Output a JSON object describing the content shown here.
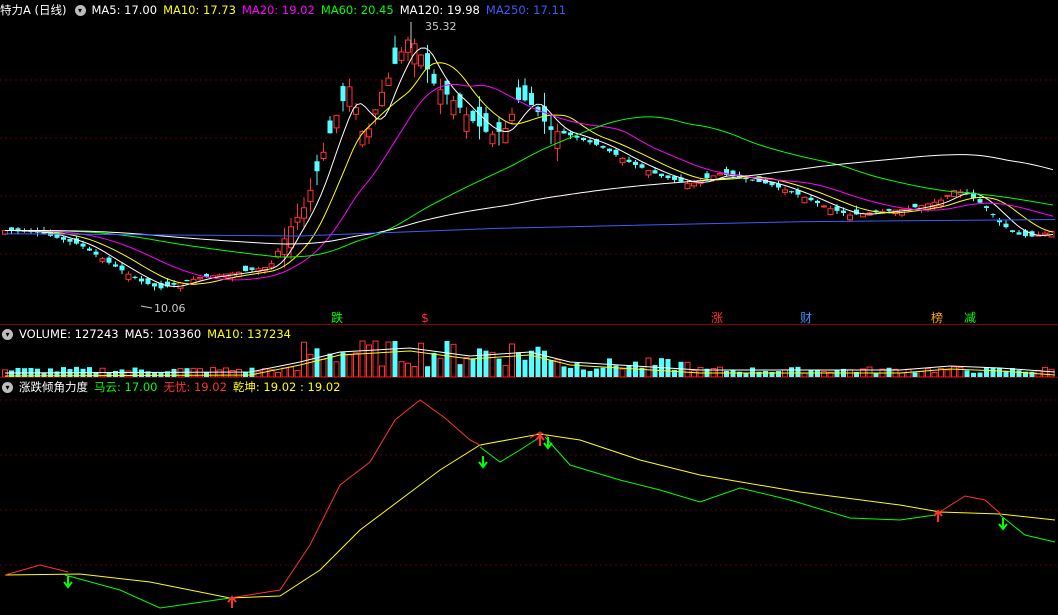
{
  "price_panel": {
    "title": "特力A (日线)",
    "ma": [
      {
        "label": "MA5: 17.00",
        "color": "#ffffff"
      },
      {
        "label": "MA10: 17.73",
        "color": "#ffff00"
      },
      {
        "label": "MA20: 19.02",
        "color": "#ff00ff"
      },
      {
        "label": "MA60: 20.45",
        "color": "#00ff00"
      },
      {
        "label": "MA120: 19.98",
        "color": "#ffffff"
      },
      {
        "label": "MA250: 17.11",
        "color": "#3a5cff"
      }
    ],
    "high_label": "35.32",
    "low_label": "10.06",
    "markers": [
      {
        "text": "跌",
        "color": "#00ff00"
      },
      {
        "text": "$",
        "color": "#ff3030"
      },
      {
        "text": "涨",
        "color": "#ff3030"
      },
      {
        "text": "财",
        "color": "#3a8cff"
      },
      {
        "text": "榜",
        "color": "#ffa500"
      },
      {
        "text": "减",
        "color": "#00ff00"
      }
    ]
  },
  "volume_panel": {
    "labels": [
      {
        "label": "VOLUME: 127243",
        "color": "#ffffff"
      },
      {
        "label": "MA5: 103360",
        "color": "#ffffff"
      },
      {
        "label": "MA10: 137234",
        "color": "#ffff00"
      }
    ]
  },
  "indicator_panel": {
    "labels": [
      {
        "label": "涨跌倾角力度",
        "color": "#ffffff"
      },
      {
        "label": "马云: 17.00",
        "color": "#00ff00"
      },
      {
        "label": "无忧: 19.02",
        "color": "#ff3030"
      },
      {
        "label": "乾坤: 19.02 : 19.02",
        "color": "#ffff00"
      }
    ]
  },
  "colors": {
    "up": "#ff3030",
    "down": "#54ffff",
    "grid": "#5a0000"
  },
  "icons": {
    "panel_toggle": "chevron-down-icon"
  },
  "chart_data": [
    {
      "type": "candlestick",
      "title": "特力A (日线)",
      "ylim": [
        10,
        36
      ],
      "high": 35.32,
      "low": 10.06,
      "series": [
        {
          "name": "MA5",
          "values": [
            17.0
          ]
        },
        {
          "name": "MA10",
          "values": [
            17.73
          ]
        },
        {
          "name": "MA20",
          "values": [
            19.02
          ]
        },
        {
          "name": "MA60",
          "values": [
            20.45
          ]
        },
        {
          "name": "MA120",
          "values": [
            19.98
          ]
        },
        {
          "name": "MA250",
          "values": [
            17.11
          ]
        }
      ]
    },
    {
      "type": "bar",
      "series": [
        {
          "name": "VOLUME",
          "values": [
            127243
          ]
        },
        {
          "name": "MA5",
          "values": [
            103360
          ]
        },
        {
          "name": "MA10",
          "values": [
            137234
          ]
        }
      ]
    },
    {
      "type": "line",
      "title": "涨跌倾角力度",
      "series": [
        {
          "name": "马云",
          "values": [
            17.0
          ]
        },
        {
          "name": "无忧",
          "values": [
            19.02
          ]
        },
        {
          "name": "乾坤",
          "values": [
            19.02
          ]
        }
      ]
    }
  ]
}
